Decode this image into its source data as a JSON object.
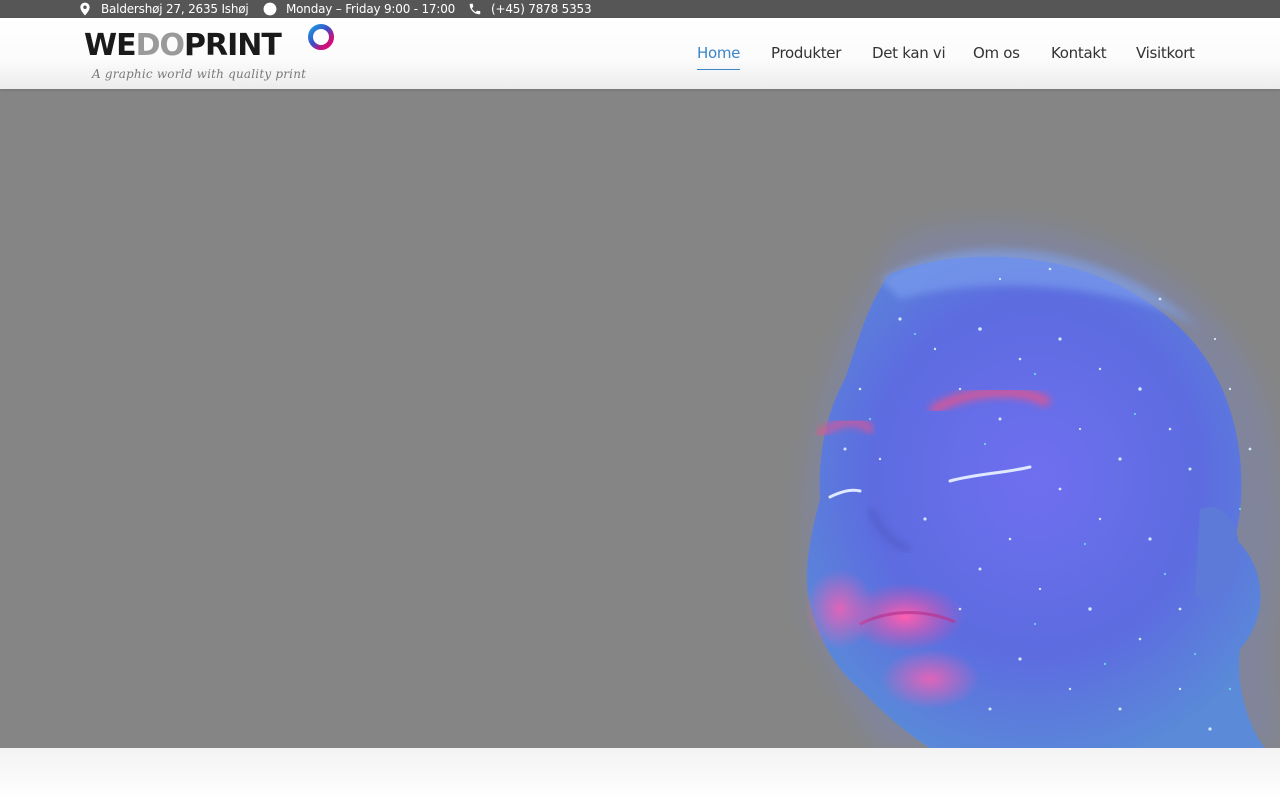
{
  "topbar": {
    "address": "Baldershøj 27, 2635 Ishøj",
    "hours": "Monday – Friday 9:00 - 17:00",
    "phone": "(+45) 7878 5353",
    "icons": [
      "location-pin-icon",
      "clock-icon",
      "phone-icon"
    ]
  },
  "logo": {
    "part1": "WE",
    "part2": "DO",
    "part3": "PRINT",
    "tagline": "A graphic world with quality print"
  },
  "nav": {
    "items": [
      {
        "label": "Home",
        "active": true
      },
      {
        "label": "Produkter",
        "active": false
      },
      {
        "label": "Det kan vi",
        "active": false
      },
      {
        "label": "Om os",
        "active": false
      },
      {
        "label": "Kontakt",
        "active": false
      },
      {
        "label": "Visitkort",
        "active": false
      }
    ]
  },
  "hero": {
    "heading": ""
  },
  "colors": {
    "topbar_bg": "#565656",
    "hero_bg": "#858585",
    "accent": "#3a86c8",
    "text": "#333333"
  }
}
